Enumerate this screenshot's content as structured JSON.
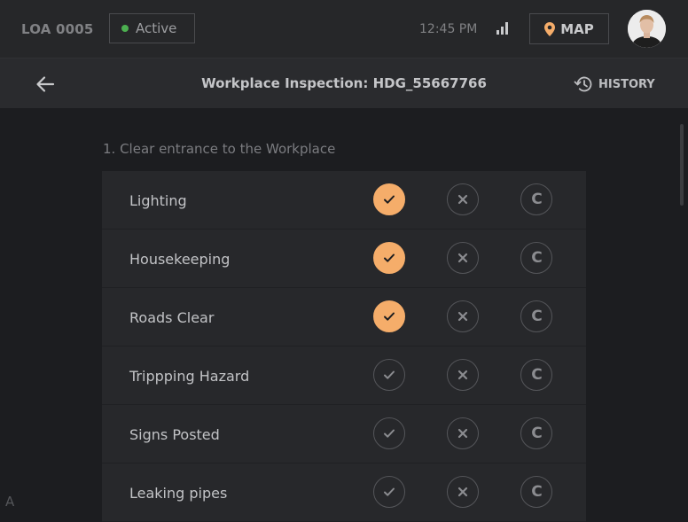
{
  "header": {
    "loa_id": "LOA 0005",
    "status_label": "Active",
    "status_color": "#4caf50",
    "time": "12:45 PM",
    "map_label": "MAP"
  },
  "subheader": {
    "title": "Workplace Inspection: HDG_55667766",
    "history_label": "HISTORY"
  },
  "section": {
    "title": "1. Clear entrance to the Workplace",
    "accent_color": "#f5ad6a",
    "items": [
      {
        "label": "Lighting",
        "selected": "check"
      },
      {
        "label": "Housekeeping",
        "selected": "check"
      },
      {
        "label": "Roads Clear",
        "selected": "check"
      },
      {
        "label": "Trippping Hazard",
        "selected": null
      },
      {
        "label": "Signs Posted",
        "selected": null
      },
      {
        "label": "Leaking pipes",
        "selected": null
      }
    ],
    "option_icons": [
      "check-icon",
      "cross-icon",
      "c-icon"
    ]
  },
  "corner_letter": "A"
}
